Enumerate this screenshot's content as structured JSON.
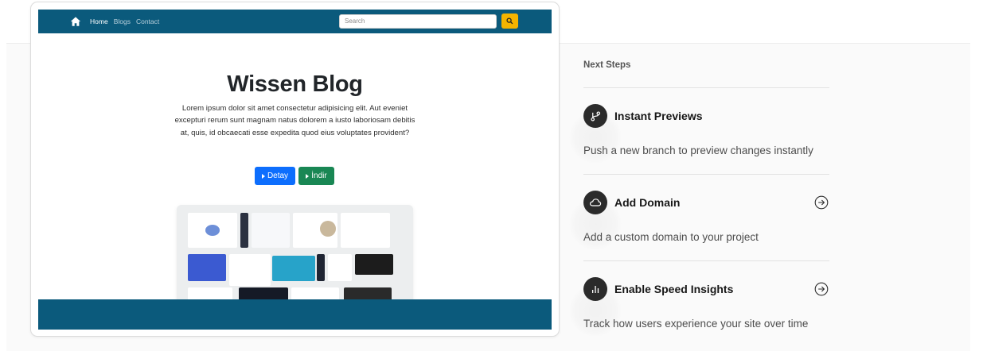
{
  "preview": {
    "nav": {
      "home": "Home",
      "blogs": "Blogs",
      "contact": "Contact"
    },
    "search_placeholder": "Search",
    "hero_title": "Wissen Blog",
    "hero_text": "Lorem ipsum dolor sit amet consectetur adipisicing elit. Aut eveniet excepturi rerum sunt magnam natus dolorem a iusto laboriosam debitis at, quis, id obcaecati esse expedita quod eius voluptates provident?",
    "button_detay": "Detay",
    "button_indir": "İndir",
    "colors": {
      "nav": "#0b5a7c",
      "search_button": "#f5b400",
      "detay": "#0d6efd",
      "indir": "#198754"
    }
  },
  "next_steps": {
    "heading": "Next Steps",
    "items": [
      {
        "title": "Instant Previews",
        "description": "Push a new branch to preview changes instantly",
        "icon": "git-branch-icon",
        "has_arrow": false
      },
      {
        "title": "Add Domain",
        "description": "Add a custom domain to your project",
        "icon": "cloud-icon",
        "has_arrow": true
      },
      {
        "title": "Enable Speed Insights",
        "description": "Track how users experience your site over time",
        "icon": "bar-chart-icon",
        "has_arrow": true
      }
    ]
  }
}
